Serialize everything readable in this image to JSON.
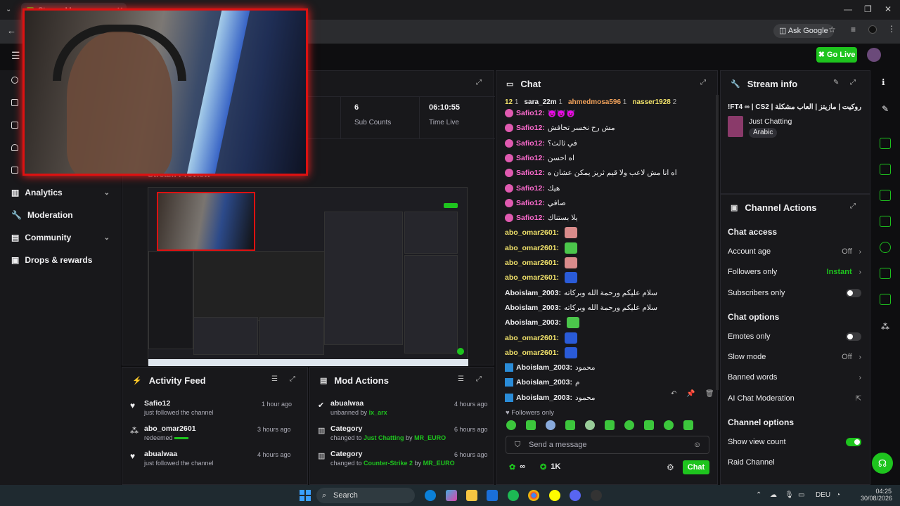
{
  "browser": {
    "ask_google": "Ask Google",
    "tab_title": "Stream Manager"
  },
  "topbar": {
    "go_live": "Go Live"
  },
  "leftnav": {
    "items": [
      {
        "label": "Analytics",
        "icon": "chart-icon",
        "has_chevron": true
      },
      {
        "label": "Moderation",
        "icon": "wrench-icon",
        "has_chevron": false
      },
      {
        "label": "Community",
        "icon": "people-icon",
        "has_chevron": true
      },
      {
        "label": "Drops & rewards",
        "icon": "gift-icon",
        "has_chevron": false
      }
    ]
  },
  "stats": {
    "sub_counts_value": "6",
    "sub_counts_label": "Sub Counts",
    "time_live_value": "06:10:55",
    "time_live_label": "Time Live"
  },
  "stream_preview": {
    "title": "Stream Preview"
  },
  "chat": {
    "title": "Chat",
    "top_bar": [
      {
        "name": "12",
        "count": "1"
      },
      {
        "name": "sara_22m",
        "count": "1"
      },
      {
        "name": "ahmedmosa596",
        "count": "1"
      },
      {
        "name": "nasser1928",
        "count": "2"
      }
    ],
    "messages": [
      {
        "user": "Safio12:",
        "text": "😈😈😈",
        "badge": "pink",
        "color": "pink"
      },
      {
        "user": "Safio12:",
        "text": "مش رح نخسر تخافش",
        "badge": "pink",
        "color": "pink"
      },
      {
        "user": "Safio12:",
        "text": "في ثالث؟",
        "badge": "pink",
        "color": "pink"
      },
      {
        "user": "Safio12:",
        "text": "اه احسن",
        "badge": "pink",
        "color": "pink"
      },
      {
        "user": "Safio12:",
        "text": "اه انا مش لاعب ولا قيم ثريز يمكن عشان ه",
        "badge": "pink",
        "color": "pink"
      },
      {
        "user": "Safio12:",
        "text": "هيك",
        "badge": "pink",
        "color": "pink"
      },
      {
        "user": "Safio12:",
        "text": "صافي",
        "badge": "pink",
        "color": "pink"
      },
      {
        "user": "Safio12:",
        "text": "يلا بستناك",
        "badge": "pink",
        "color": "pink"
      },
      {
        "user": "abo_omar2601:",
        "text": "",
        "badge": "none",
        "color": "yellow",
        "emote": "#d98b8b"
      },
      {
        "user": "abo_omar2601:",
        "text": "",
        "badge": "none",
        "color": "yellow",
        "emote": "#4bc64b"
      },
      {
        "user": "abo_omar2601:",
        "text": "",
        "badge": "none",
        "color": "yellow",
        "emote": "#d98b8b"
      },
      {
        "user": "abo_omar2601:",
        "text": "",
        "badge": "none",
        "color": "yellow",
        "emote": "#2a5bd8"
      },
      {
        "user": "Aboislam_2003:",
        "text": "سلام عليكم ورحمة الله وبركاته",
        "badge": "none",
        "color": "white"
      },
      {
        "user": "Aboislam_2003:",
        "text": "سلام عليكم ورحمة الله وبركاته",
        "badge": "none",
        "color": "white"
      },
      {
        "user": "Aboislam_2003:",
        "text": "",
        "badge": "none",
        "color": "white",
        "emote": "#4bc64b"
      },
      {
        "user": "abo_omar2601:",
        "text": "",
        "badge": "none",
        "color": "yellow",
        "emote": "#2a5bd8"
      },
      {
        "user": "abo_omar2601:",
        "text": "",
        "badge": "none",
        "color": "yellow",
        "emote": "#2a5bd8"
      },
      {
        "user": "Aboislam_2003:",
        "text": "محمود",
        "badge": "blue",
        "color": "white"
      },
      {
        "user": "Aboislam_2003:",
        "text": "م",
        "badge": "blue",
        "color": "white"
      },
      {
        "user": "Aboislam_2003:",
        "text": "محمود",
        "badge": "blue",
        "color": "white"
      }
    ],
    "followers_only": "Followers only",
    "send_placeholder": "Send a message",
    "points_1": "∞",
    "points_2": "1K",
    "chat_button": "Chat"
  },
  "stream_info": {
    "title": "Stream info",
    "stream_title": "!FT4 ∞ | CS2 | روكيت | مازيتز | العاب مشكلة",
    "category": "Just Chatting",
    "tag": "Arabic"
  },
  "channel_actions": {
    "title": "Channel Actions",
    "chat_access": "Chat access",
    "account_age_label": "Account age",
    "account_age_value": "Off",
    "followers_only_label": "Followers only",
    "followers_only_value": "Instant",
    "subscribers_only_label": "Subscribers only",
    "chat_options": "Chat options",
    "emotes_only_label": "Emotes only",
    "slow_mode_label": "Slow mode",
    "slow_mode_value": "Off",
    "banned_words_label": "Banned words",
    "ai_mod_label": "AI Chat Moderation",
    "channel_options": "Channel options",
    "show_view_count_label": "Show view count",
    "raid_channel_label": "Raid Channel"
  },
  "activity_feed": {
    "title": "Activity Feed",
    "items": [
      {
        "name": "Safio12",
        "sub": "just followed the channel",
        "time": "1 hour ago",
        "icon": "heart-icon"
      },
      {
        "name": "abo_omar2601",
        "sub": "redeemed",
        "time": "3 hours ago",
        "icon": "redeem-icon"
      },
      {
        "name": "abualwaa",
        "sub": "just followed the channel",
        "time": "4 hours ago",
        "icon": "heart-icon"
      }
    ]
  },
  "mod_actions": {
    "title": "Mod Actions",
    "items": [
      {
        "name": "abualwaa",
        "pre": "unbanned by ",
        "link": "ix_arx",
        "mid": "",
        "link2": "",
        "time": "4 hours ago"
      },
      {
        "name": "Category",
        "pre": "changed to ",
        "link": "Just Chatting",
        "mid": " by ",
        "link2": "MR_EURO",
        "time": "6 hours ago"
      },
      {
        "name": "Category",
        "pre": "changed to ",
        "link": "Counter-Strike 2",
        "mid": " by ",
        "link2": "MR_EURO",
        "time": "6 hours ago"
      }
    ]
  },
  "taskbar": {
    "search": "Search",
    "lang": "DEU",
    "time": "04:25",
    "date": "30/08/2026"
  },
  "colors": {
    "accent_green": "#1ec41e",
    "panel_bg": "#18181b",
    "page_bg": "#0e0e10",
    "pink_nick": "#ff6bd0"
  }
}
